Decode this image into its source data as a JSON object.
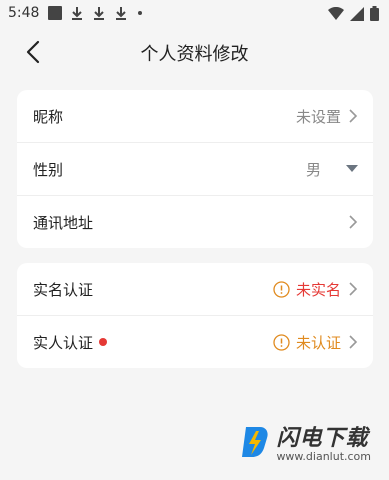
{
  "status_bar": {
    "time": "5:48",
    "icons": [
      "notification-square-icon",
      "download-icon",
      "download-icon",
      "download-icon",
      "more-dot-icon",
      "wifi-icon",
      "signal-icon",
      "battery-icon"
    ]
  },
  "header": {
    "title": "个人资料修改"
  },
  "profile_section": {
    "rows": [
      {
        "label": "昵称",
        "value": "未设置"
      },
      {
        "label": "性别",
        "value": "男"
      },
      {
        "label": "通讯地址",
        "value": ""
      }
    ]
  },
  "verification_section": {
    "rows": [
      {
        "label": "实名认证",
        "value": "未实名",
        "status_color": "#e53935"
      },
      {
        "label": "实人认证",
        "value": "未认证",
        "status_color": "#e08a1e",
        "has_dot": true
      }
    ]
  },
  "watermark": {
    "title": "闪电下载",
    "url": "www.dianlut.com"
  },
  "colors": {
    "background": "#f5f5f5",
    "card": "#ffffff",
    "warn_red": "#e53935",
    "warn_orange": "#e08a1e",
    "brand_blue": "#1e88e5",
    "brand_yellow": "#f5b800"
  }
}
